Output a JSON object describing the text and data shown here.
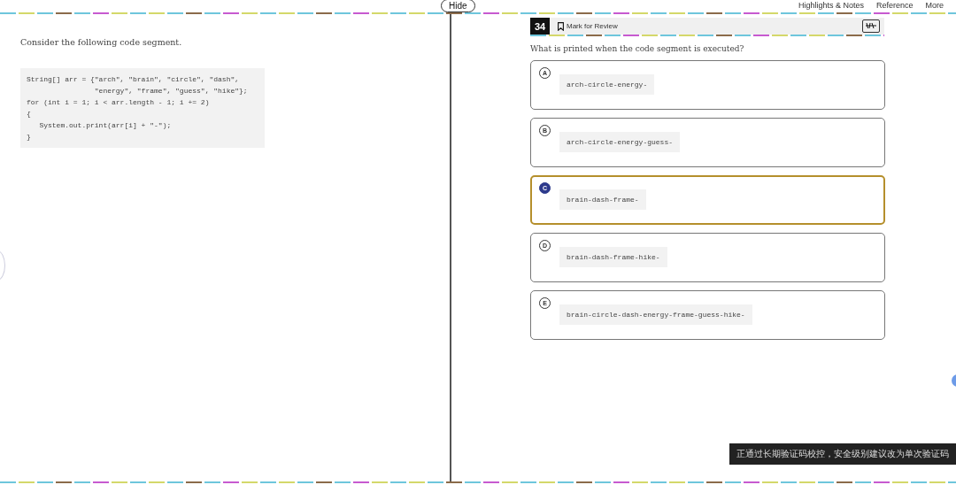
{
  "top_bar": {
    "hide_button": "Hide",
    "menu": [
      "Highlights & Notes",
      "Reference",
      "More"
    ]
  },
  "passage": {
    "intro": "Consider the following code segment.",
    "code": [
      "String[] arr = {\"arch\", \"brain\", \"circle\", \"dash\",",
      "                \"energy\", \"frame\", \"guess\", \"hike\"};",
      "for (int i = 1; i < arr.length - 1; i += 2)",
      "{",
      "   System.out.print(arr[i] + \"-\");",
      "}"
    ]
  },
  "question": {
    "number": "34",
    "mark_for_review": {
      "label": "Mark for Review",
      "checked": false
    },
    "prompt": "What is printed when the code segment is executed?",
    "options": [
      {
        "letter": "A",
        "text": "arch-circle-energy-",
        "selected": false
      },
      {
        "letter": "B",
        "text": "arch-circle-energy-guess-",
        "selected": false
      },
      {
        "letter": "C",
        "text": "brain-dash-frame-",
        "selected": true
      },
      {
        "letter": "D",
        "text": "brain-dash-frame-hike-",
        "selected": false
      },
      {
        "letter": "E",
        "text": "brain-circle-dash-energy-frame-guess-hike-",
        "selected": false
      }
    ]
  },
  "toast": {
    "text": "正通过长期验证码校控，安全级别建议改为单次验证码"
  }
}
